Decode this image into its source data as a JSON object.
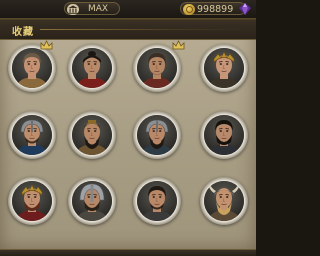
{
  "top_bar": {
    "left_label": "MAX",
    "left_icon": "temple-icon",
    "gold_amount": "998899",
    "gold_icon": "gold-coin-icon",
    "right_icon": "purple-crystal-icon"
  },
  "panel": {
    "title": "收藏"
  },
  "portraits": [
    {
      "id": "hero-1",
      "badge": true,
      "helmet": "none",
      "hair": "#6b5a45",
      "skin": "#c49273",
      "beard": "none",
      "armor": "#8a6a3c"
    },
    {
      "id": "hero-2",
      "badge": false,
      "helmet": "topknot",
      "hair": "#1b1611",
      "skin": "#b98a6a",
      "beard": "none",
      "armor": "#7a1f1c"
    },
    {
      "id": "hero-3",
      "badge": true,
      "helmet": "none",
      "hair": "#3c2e24",
      "skin": "#b58664",
      "beard": "stubble",
      "armor": "#6a2a22"
    },
    {
      "id": "hero-4",
      "badge": false,
      "helmet": "crown",
      "hair": "#2a1c14",
      "skin": "#c79577",
      "beard": "none",
      "armor": "#3b3327"
    },
    {
      "id": "hero-5",
      "badge": false,
      "helmet": "helmet",
      "hair": "#2b2018",
      "skin": "#bd8d6c",
      "beard": "short",
      "armor": "#1f3b5c"
    },
    {
      "id": "hero-6",
      "badge": false,
      "helmet": "cap",
      "hair": "#1c1712",
      "skin": "#b88766",
      "beard": "long",
      "armor": "#6d5532"
    },
    {
      "id": "hero-7",
      "badge": false,
      "helmet": "helmet",
      "hair": "#1e1813",
      "skin": "#b98868",
      "beard": "long",
      "armor": "#2c3b46"
    },
    {
      "id": "hero-8",
      "badge": false,
      "helmet": "none",
      "hair": "#15110d",
      "skin": "#b8896a",
      "beard": "full",
      "armor": "#2c2f34"
    },
    {
      "id": "hero-9",
      "badge": false,
      "helmet": "crown",
      "hair": "#5b2a1a",
      "skin": "#c09070",
      "beard": "full",
      "armor": "#6d1d1d"
    },
    {
      "id": "hero-10",
      "badge": false,
      "helmet": "steel",
      "hair": "#2a2018",
      "skin": "#b68868",
      "beard": "full",
      "armor": "#4a4640"
    },
    {
      "id": "hero-11",
      "badge": false,
      "helmet": "none",
      "hair": "#201812",
      "skin": "#b88868",
      "beard": "short",
      "armor": "#3a3a3a"
    },
    {
      "id": "hero-12",
      "badge": false,
      "helmet": "horned",
      "hair": "#c9a35c",
      "skin": "#c3926f",
      "beard": "long",
      "armor": "#5a4a36"
    }
  ]
}
